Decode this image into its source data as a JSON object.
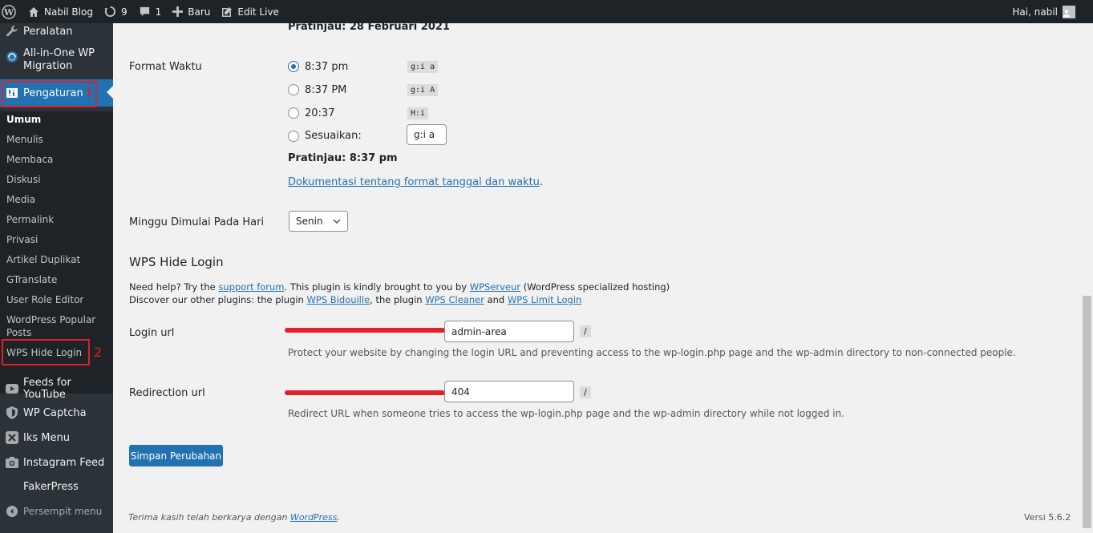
{
  "admin_bar": {
    "site_name": "Nabil Blog",
    "updates_count": "9",
    "comments_count": "1",
    "new_label": "Baru",
    "edit_label": "Edit Live",
    "greeting": "Hai, nabil"
  },
  "sidebar": {
    "top_items": [
      {
        "label": "Peralatan",
        "icon": "wrench-icon"
      },
      {
        "label": "All-in-One WP Migration",
        "icon": "migration-icon"
      },
      {
        "label": "Pengaturan",
        "icon": "settings-icon"
      }
    ],
    "submenu": [
      "Umum",
      "Menulis",
      "Membaca",
      "Diskusi",
      "Media",
      "Permalink",
      "Privasi",
      "Artikel Duplikat",
      "GTranslate",
      "User Role Editor",
      "WordPress Popular Posts",
      "WPS Hide Login"
    ],
    "bottom_items": [
      {
        "label": "Feeds for YouTube",
        "icon": "youtube-icon"
      },
      {
        "label": "WP Captcha",
        "icon": "shield-icon"
      },
      {
        "label": "Iks Menu",
        "icon": "x-icon"
      },
      {
        "label": "Instagram Feed",
        "icon": "camera-icon"
      },
      {
        "label": "FakerPress",
        "icon": ""
      },
      {
        "label": "Persempit menu",
        "icon": "collapse-icon"
      }
    ],
    "annotations": [
      "1",
      "2"
    ]
  },
  "main": {
    "date_preview": "Pratinjau: 28 Februari 2021",
    "time_format": {
      "label": "Format Waktu",
      "options": [
        {
          "label": "8:37 pm",
          "code": "g:i a",
          "checked": true
        },
        {
          "label": "8:37 PM",
          "code": "g:i A",
          "checked": false
        },
        {
          "label": "20:37",
          "code": "H:i",
          "checked": false
        }
      ],
      "custom_label": "Sesuaikan:",
      "custom_value": "g:i a",
      "preview": "Pratinjau: 8:37 pm",
      "doc_link": "Dokumentasi tentang format tanggal dan waktu",
      "doc_suffix": "."
    },
    "week_start": {
      "label": "Minggu Dimulai Pada Hari",
      "value": "Senin"
    },
    "wps": {
      "heading": "WPS Hide Login",
      "help1_a": "Need help? Try the ",
      "help1_link1": "support forum",
      "help1_b": ". This plugin is kindly brought to you by ",
      "help1_link2": "WPServeur",
      "help1_c": " (WordPress specialized hosting)",
      "help2_a": "Discover our other plugins: the plugin ",
      "help2_link1": "WPS Bidouille",
      "help2_b": ", the plugin ",
      "help2_link2": "WPS Cleaner",
      "help2_c": " and ",
      "help2_link3": "WPS Limit Login",
      "login_url_label": "Login url",
      "login_url_value": "admin-area",
      "login_url_desc": "Protect your website by changing the login URL and preventing access to the wp-login.php page and the wp-admin directory to non-connected people.",
      "redirect_label": "Redirection url",
      "redirect_value": "404",
      "redirect_desc": "Redirect URL when someone tries to access the wp-login.php page and the wp-admin directory while not logged in.",
      "slash": "/"
    },
    "save_button": "Simpan Perubahan"
  },
  "footer": {
    "thanks_a": "Terima kasih telah berkarya dengan ",
    "thanks_link": "WordPress",
    "thanks_b": ".",
    "version": "Versi 5.6.2"
  },
  "colors": {
    "admin_bar": "#1d2327",
    "sidebar": "#2c3338",
    "accent": "#2271b1",
    "annotation": "#e0202a"
  }
}
